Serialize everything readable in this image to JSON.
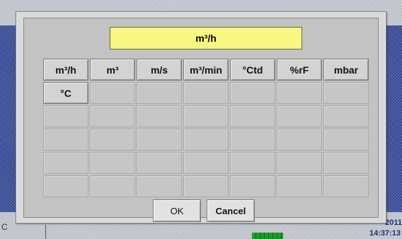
{
  "background": {
    "left_label": "C",
    "year_partial": "2011",
    "time": "14:37:13"
  },
  "dialog": {
    "title": "m³/h",
    "units_row1": [
      "m³/h",
      "m³",
      "m/s",
      "m³/min",
      "°Ctd",
      "%rF",
      "mbar"
    ],
    "units_row2": [
      "°C"
    ],
    "ok_label": "OK",
    "cancel_label": "Cancel"
  },
  "colors": {
    "title_bg": "#f7f782",
    "dialog_bg": "#d9d9d9",
    "status_led": "#1d9a2b"
  }
}
